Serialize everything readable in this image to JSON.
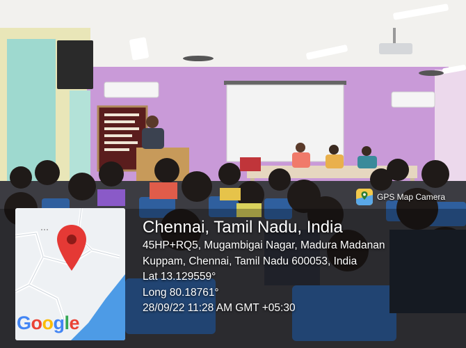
{
  "stamp": {
    "app_name": "GPS Map Camera",
    "city": "Chennai, Tamil Nadu, India",
    "address_line_1": "45HP+RQ5, Mugambigai Nagar, Madura Madanan",
    "address_line_2": "Kuppam, Chennai, Tamil Nadu 600053, India",
    "latitude": "Lat 13.129559°",
    "longitude": "Long 80.18761°",
    "timestamp": "28/09/22 11:28 AM GMT +05:30",
    "map_brand": "Google"
  },
  "colors": {
    "wall_pink": "#c99ad8",
    "chair_blue": "#2f5f9e",
    "map_marker": "#e53935",
    "map_water": "#4d9be6",
    "google_blue": "#4285f4",
    "google_red": "#ea4335",
    "google_yellow": "#fbbc05",
    "google_green": "#34a853"
  }
}
